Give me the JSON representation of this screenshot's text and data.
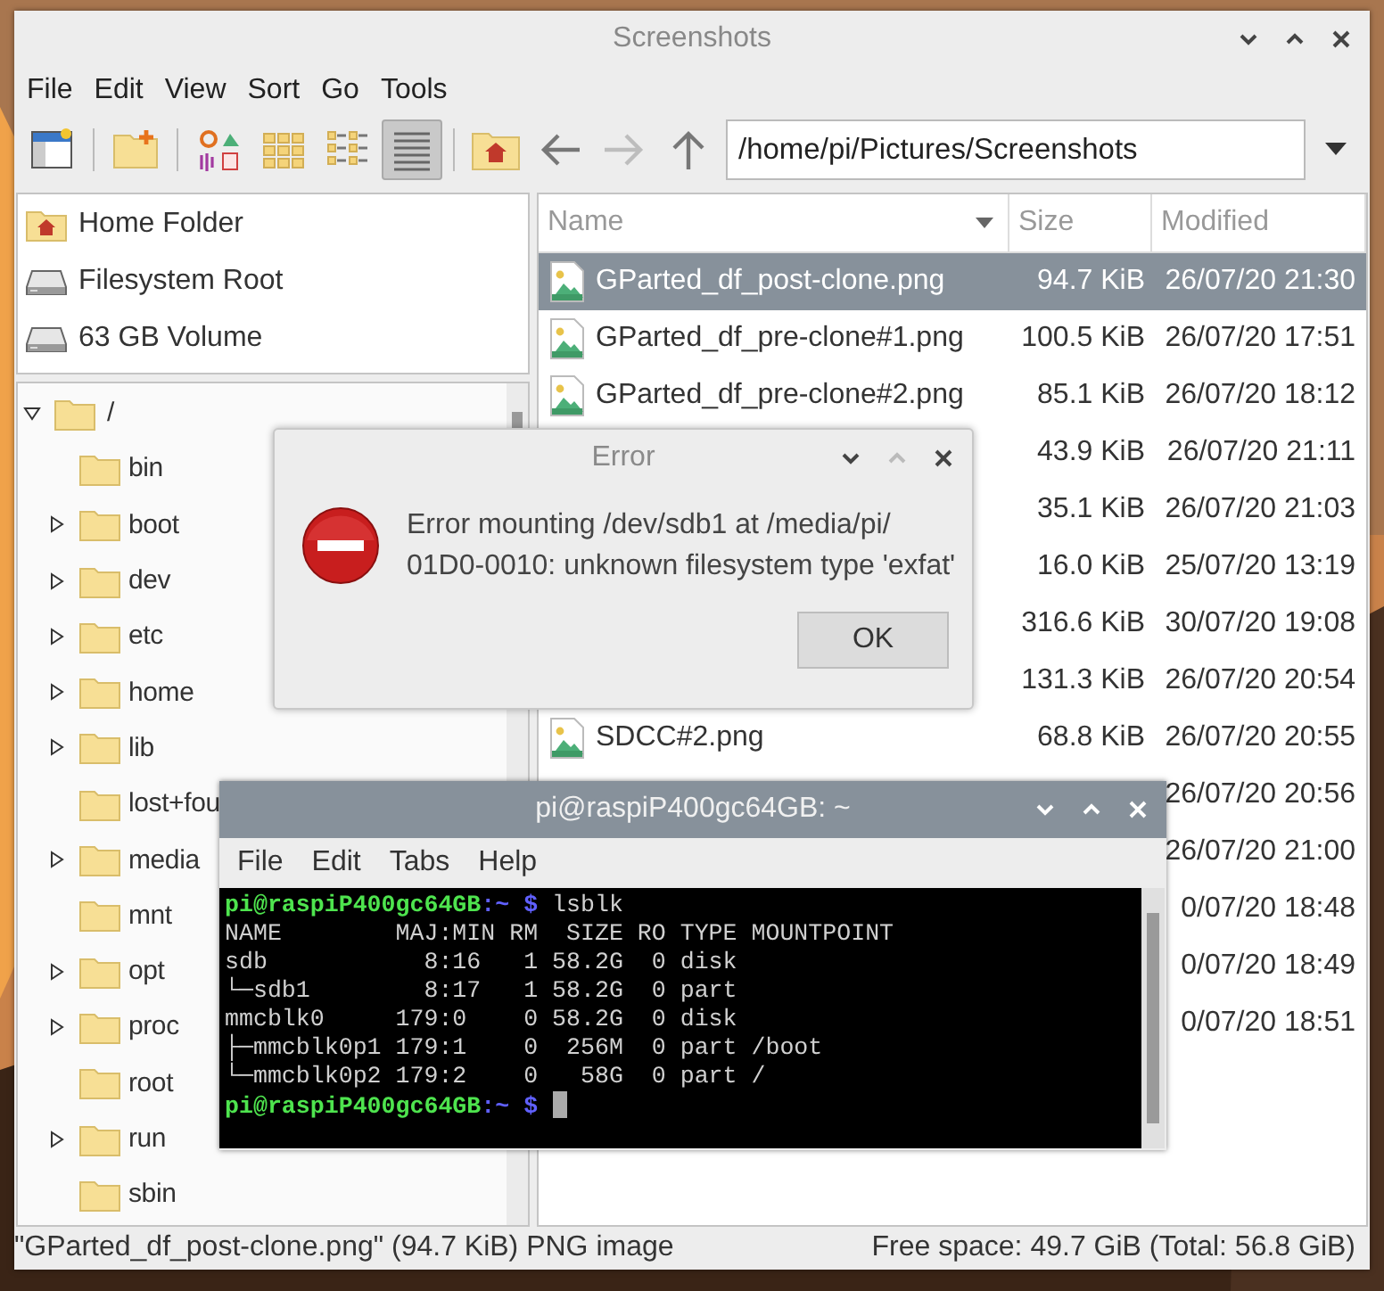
{
  "file_manager": {
    "title": "Screenshots",
    "menu": [
      "File",
      "Edit",
      "View",
      "Sort",
      "Go",
      "Tools"
    ],
    "toolbar": [
      {
        "kind": "new-window"
      },
      {
        "kind": "new-folder"
      }
    ],
    "view_modes": [
      {
        "kind": "icon",
        "selected": false
      },
      {
        "kind": "thumbnail",
        "selected": false
      },
      {
        "kind": "compact",
        "selected": false
      },
      {
        "kind": "detailed",
        "selected": true
      }
    ],
    "navigation": [
      {
        "kind": "home",
        "disabled": false
      },
      {
        "kind": "back",
        "disabled": false
      },
      {
        "kind": "forward",
        "disabled": true
      },
      {
        "kind": "up",
        "disabled": false
      }
    ],
    "path": "/home/pi/Pictures/Screenshots",
    "places": [
      {
        "kind": "home",
        "label": "Home Folder"
      },
      {
        "kind": "drive",
        "label": "Filesystem Root"
      },
      {
        "kind": "drive",
        "label": "63 GB Volume"
      }
    ],
    "tree": {
      "label": "/",
      "expanded": true,
      "children": [
        {
          "label": "bin",
          "has_children": false
        },
        {
          "label": "boot",
          "has_children": true
        },
        {
          "label": "dev",
          "has_children": true
        },
        {
          "label": "etc",
          "has_children": true
        },
        {
          "label": "home",
          "has_children": true
        },
        {
          "label": "lib",
          "has_children": true
        },
        {
          "label": "lost+fou",
          "has_children": false
        },
        {
          "label": "media",
          "has_children": true
        },
        {
          "label": "mnt",
          "has_children": false
        },
        {
          "label": "opt",
          "has_children": true
        },
        {
          "label": "proc",
          "has_children": true
        },
        {
          "label": "root",
          "has_children": false
        },
        {
          "label": "run",
          "has_children": true
        },
        {
          "label": "sbin",
          "has_children": false
        }
      ]
    },
    "files": {
      "columns": [
        {
          "label": "Name",
          "sorted": true
        },
        {
          "label": "Size",
          "sorted": false
        },
        {
          "label": "Modified",
          "sorted": false
        }
      ],
      "rows": [
        {
          "name": "GParted_df_post-clone.png",
          "size": "94.7 KiB",
          "modified": "26/07/20 21:30",
          "selected": true
        },
        {
          "name": "GParted_df_pre-clone#1.png",
          "size": "100.5 KiB",
          "modified": "26/07/20 17:51",
          "selected": false
        },
        {
          "name": "GParted_df_pre-clone#2.png",
          "size": "85.1 KiB",
          "modified": "26/07/20 18:12",
          "selected": false
        },
        {
          "size": "43.9 KiB",
          "modified": "26/07/20 21:11",
          "selected": false
        },
        {
          "size": "35.1 KiB",
          "modified": "26/07/20 21:03",
          "selected": false
        },
        {
          "size": "16.0 KiB",
          "modified": "25/07/20 13:19",
          "selected": false
        },
        {
          "size": "316.6 KiB",
          "modified": "30/07/20 19:08",
          "selected": false
        },
        {
          "size": "131.3 KiB",
          "modified": "26/07/20 20:54",
          "selected": false
        },
        {
          "name": "SDCC#2.png",
          "size": "68.8 KiB",
          "modified": "26/07/20 20:55",
          "selected": false
        },
        {
          "modified": "26/07/20 20:56",
          "selected": false
        },
        {
          "modified": "26/07/20 21:00",
          "selected": false
        },
        {
          "modified": "0/07/20 18:48",
          "selected": false
        },
        {
          "modified": "0/07/20 18:49",
          "selected": false
        },
        {
          "modified": "0/07/20 18:51",
          "selected": false
        }
      ]
    },
    "status_bar": {
      "selection": "\"GParted_df_post-clone.png\" (94.7 KiB) PNG image",
      "free_space": "Free space: 49.7 GiB (Total: 56.8 GiB)"
    }
  },
  "error_dialog": {
    "title": "Error",
    "message": "Error mounting /dev/sdb1 at /media/pi/01D0-0010: unknown filesystem type 'exfat'",
    "button": "OK"
  },
  "terminal": {
    "title": "pi@raspiP400gc64GB: ~",
    "menu": [
      "File",
      "Edit",
      "Tabs",
      "Help"
    ],
    "lines": [
      {
        "kind": "prompt",
        "user": "pi@raspiP400gc64GB",
        "path": ":~",
        "symbol": "$",
        "command": "lsblk",
        "cursor": false
      },
      {
        "kind": "output",
        "text": "NAME        MAJ:MIN RM  SIZE RO TYPE MOUNTPOINT"
      },
      {
        "kind": "output",
        "text": "sdb           8:16   1 58.2G  0 disk"
      },
      {
        "kind": "output",
        "text": "└─sdb1        8:17   1 58.2G  0 part"
      },
      {
        "kind": "output",
        "text": "mmcblk0     179:0    0 58.2G  0 disk"
      },
      {
        "kind": "output",
        "text": "├─mmcblk0p1 179:1    0  256M  0 part /boot"
      },
      {
        "kind": "output",
        "text": "└─mmcblk0p2 179:2    0   58G  0 part /"
      },
      {
        "kind": "prompt",
        "user": "pi@raspiP400gc64GB",
        "path": ":~",
        "symbol": "$",
        "cursor": true
      }
    ]
  }
}
